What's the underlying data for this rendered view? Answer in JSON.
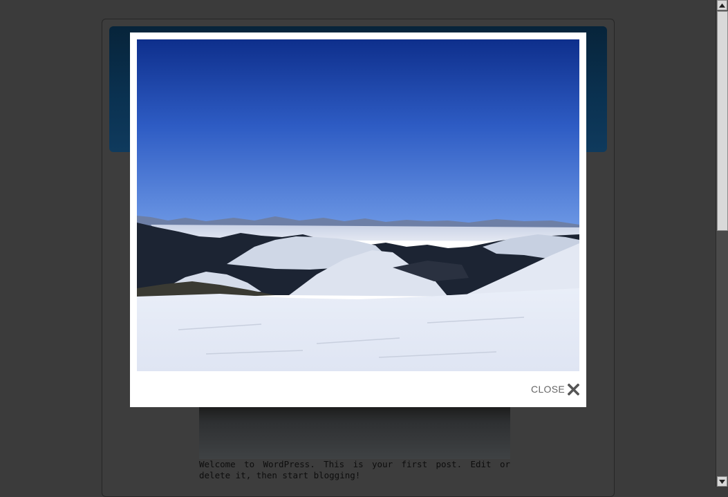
{
  "post": {
    "excerpt": "Welcome to WordPress. This is your first post. Edit or delete it, then start blogging!"
  },
  "lightbox": {
    "image_alt": "Snowy mountain ski slope overlooking a lake under a clear blue sky",
    "close_label": "CLOSE",
    "close_icon": "close-x-icon"
  },
  "scrollbar": {
    "up_icon": "arrow-up-icon",
    "down_icon": "arrow-down-icon"
  },
  "colors": {
    "overlay": "#3b3b3b",
    "lightbox_bg": "#ffffff",
    "close_text": "#666666"
  }
}
